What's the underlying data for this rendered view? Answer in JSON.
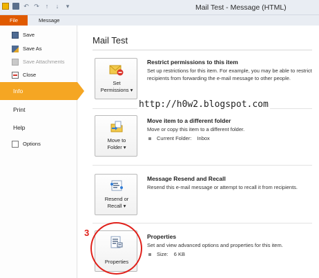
{
  "window": {
    "title": "Mail Test - Message (HTML)"
  },
  "ribbon": {
    "tabs": [
      "File",
      "Message"
    ]
  },
  "sidebar": {
    "save": "Save",
    "save_as": "Save As",
    "save_attachments": "Save Attachments",
    "close": "Close",
    "info": "Info",
    "print": "Print",
    "help": "Help",
    "options": "Options"
  },
  "main": {
    "title": "Mail Test",
    "sections": [
      {
        "button_lines": [
          "Set",
          "Permissions ▾"
        ],
        "heading": "Restrict permissions to this item",
        "description": "Set up restrictions for this item. For example, you may be able to restrict recipients from forwarding the e-mail message to other people."
      },
      {
        "button_lines": [
          "Move to",
          "Folder ▾"
        ],
        "heading": "Move item to a different folder",
        "description": "Move or copy this item to a different folder.",
        "detail_label": "Current Folder:",
        "detail_value": "Inbox"
      },
      {
        "button_lines": [
          "Resend or",
          "Recall ▾"
        ],
        "heading": "Message Resend and Recall",
        "description": "Resend this e-mail message or attempt to recall it from recipients."
      },
      {
        "button_lines": [
          "Properties"
        ],
        "heading": "Properties",
        "description": "Set and view advanced options and properties for this item.",
        "detail_label": "Size:",
        "detail_value": "6 KB"
      }
    ]
  },
  "overlay": {
    "watermark": "http://h0w2.blogspot.com",
    "step_number": "3",
    "highlight_color": "#e0201a"
  },
  "colors": {
    "file_tab": "#e05a00",
    "selected_nav": "#f5a623"
  }
}
